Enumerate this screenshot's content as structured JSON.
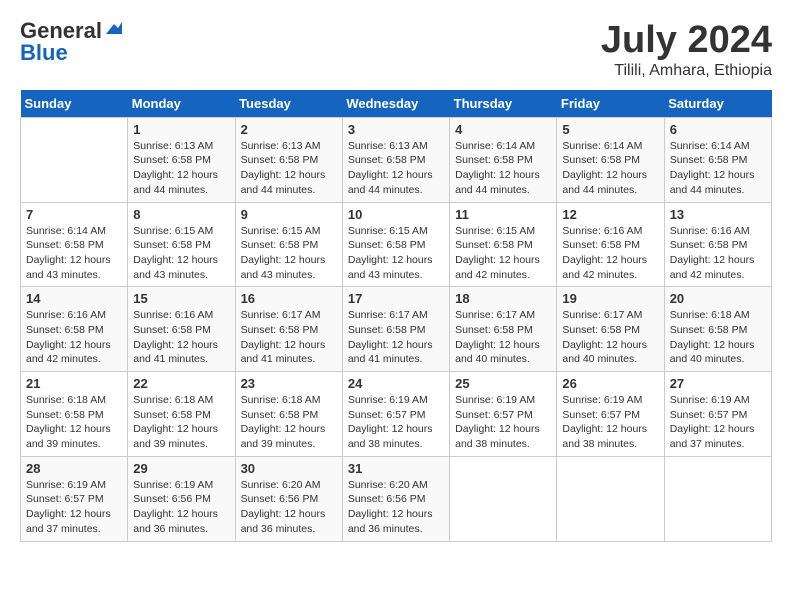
{
  "header": {
    "logo_general": "General",
    "logo_blue": "Blue",
    "month_title": "July 2024",
    "location": "Tilili, Amhara, Ethiopia"
  },
  "calendar": {
    "weekdays": [
      "Sunday",
      "Monday",
      "Tuesday",
      "Wednesday",
      "Thursday",
      "Friday",
      "Saturday"
    ],
    "weeks": [
      [
        {
          "day": "",
          "info": ""
        },
        {
          "day": "1",
          "info": "Sunrise: 6:13 AM\nSunset: 6:58 PM\nDaylight: 12 hours\nand 44 minutes."
        },
        {
          "day": "2",
          "info": "Sunrise: 6:13 AM\nSunset: 6:58 PM\nDaylight: 12 hours\nand 44 minutes."
        },
        {
          "day": "3",
          "info": "Sunrise: 6:13 AM\nSunset: 6:58 PM\nDaylight: 12 hours\nand 44 minutes."
        },
        {
          "day": "4",
          "info": "Sunrise: 6:14 AM\nSunset: 6:58 PM\nDaylight: 12 hours\nand 44 minutes."
        },
        {
          "day": "5",
          "info": "Sunrise: 6:14 AM\nSunset: 6:58 PM\nDaylight: 12 hours\nand 44 minutes."
        },
        {
          "day": "6",
          "info": "Sunrise: 6:14 AM\nSunset: 6:58 PM\nDaylight: 12 hours\nand 44 minutes."
        }
      ],
      [
        {
          "day": "7",
          "info": "Sunrise: 6:14 AM\nSunset: 6:58 PM\nDaylight: 12 hours\nand 43 minutes."
        },
        {
          "day": "8",
          "info": "Sunrise: 6:15 AM\nSunset: 6:58 PM\nDaylight: 12 hours\nand 43 minutes."
        },
        {
          "day": "9",
          "info": "Sunrise: 6:15 AM\nSunset: 6:58 PM\nDaylight: 12 hours\nand 43 minutes."
        },
        {
          "day": "10",
          "info": "Sunrise: 6:15 AM\nSunset: 6:58 PM\nDaylight: 12 hours\nand 43 minutes."
        },
        {
          "day": "11",
          "info": "Sunrise: 6:15 AM\nSunset: 6:58 PM\nDaylight: 12 hours\nand 42 minutes."
        },
        {
          "day": "12",
          "info": "Sunrise: 6:16 AM\nSunset: 6:58 PM\nDaylight: 12 hours\nand 42 minutes."
        },
        {
          "day": "13",
          "info": "Sunrise: 6:16 AM\nSunset: 6:58 PM\nDaylight: 12 hours\nand 42 minutes."
        }
      ],
      [
        {
          "day": "14",
          "info": "Sunrise: 6:16 AM\nSunset: 6:58 PM\nDaylight: 12 hours\nand 42 minutes."
        },
        {
          "day": "15",
          "info": "Sunrise: 6:16 AM\nSunset: 6:58 PM\nDaylight: 12 hours\nand 41 minutes."
        },
        {
          "day": "16",
          "info": "Sunrise: 6:17 AM\nSunset: 6:58 PM\nDaylight: 12 hours\nand 41 minutes."
        },
        {
          "day": "17",
          "info": "Sunrise: 6:17 AM\nSunset: 6:58 PM\nDaylight: 12 hours\nand 41 minutes."
        },
        {
          "day": "18",
          "info": "Sunrise: 6:17 AM\nSunset: 6:58 PM\nDaylight: 12 hours\nand 40 minutes."
        },
        {
          "day": "19",
          "info": "Sunrise: 6:17 AM\nSunset: 6:58 PM\nDaylight: 12 hours\nand 40 minutes."
        },
        {
          "day": "20",
          "info": "Sunrise: 6:18 AM\nSunset: 6:58 PM\nDaylight: 12 hours\nand 40 minutes."
        }
      ],
      [
        {
          "day": "21",
          "info": "Sunrise: 6:18 AM\nSunset: 6:58 PM\nDaylight: 12 hours\nand 39 minutes."
        },
        {
          "day": "22",
          "info": "Sunrise: 6:18 AM\nSunset: 6:58 PM\nDaylight: 12 hours\nand 39 minutes."
        },
        {
          "day": "23",
          "info": "Sunrise: 6:18 AM\nSunset: 6:58 PM\nDaylight: 12 hours\nand 39 minutes."
        },
        {
          "day": "24",
          "info": "Sunrise: 6:19 AM\nSunset: 6:57 PM\nDaylight: 12 hours\nand 38 minutes."
        },
        {
          "day": "25",
          "info": "Sunrise: 6:19 AM\nSunset: 6:57 PM\nDaylight: 12 hours\nand 38 minutes."
        },
        {
          "day": "26",
          "info": "Sunrise: 6:19 AM\nSunset: 6:57 PM\nDaylight: 12 hours\nand 38 minutes."
        },
        {
          "day": "27",
          "info": "Sunrise: 6:19 AM\nSunset: 6:57 PM\nDaylight: 12 hours\nand 37 minutes."
        }
      ],
      [
        {
          "day": "28",
          "info": "Sunrise: 6:19 AM\nSunset: 6:57 PM\nDaylight: 12 hours\nand 37 minutes."
        },
        {
          "day": "29",
          "info": "Sunrise: 6:19 AM\nSunset: 6:56 PM\nDaylight: 12 hours\nand 36 minutes."
        },
        {
          "day": "30",
          "info": "Sunrise: 6:20 AM\nSunset: 6:56 PM\nDaylight: 12 hours\nand 36 minutes."
        },
        {
          "day": "31",
          "info": "Sunrise: 6:20 AM\nSunset: 6:56 PM\nDaylight: 12 hours\nand 36 minutes."
        },
        {
          "day": "",
          "info": ""
        },
        {
          "day": "",
          "info": ""
        },
        {
          "day": "",
          "info": ""
        }
      ]
    ]
  }
}
